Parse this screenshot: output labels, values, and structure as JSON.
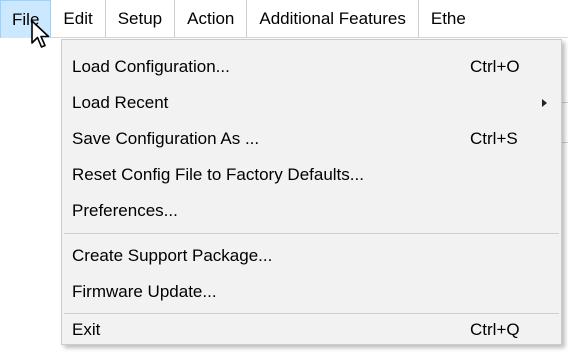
{
  "menubar": {
    "items": [
      {
        "label": "File",
        "active": true
      },
      {
        "label": "Edit"
      },
      {
        "label": "Setup"
      },
      {
        "label": "Action"
      },
      {
        "label": "Additional Features"
      },
      {
        "label": "Ethe"
      }
    ]
  },
  "file_menu": {
    "items": [
      {
        "label": "Load Configuration...",
        "shortcut": "Ctrl+O"
      },
      {
        "label": "Load Recent",
        "submenu": true
      },
      {
        "label": "Save Configuration As ...",
        "shortcut": "Ctrl+S"
      },
      {
        "label": "Reset Config File to Factory Defaults..."
      },
      {
        "label": "Preferences..."
      },
      {
        "label": "Create Support Package..."
      },
      {
        "label": "Firmware Update..."
      },
      {
        "label": "Exit",
        "shortcut": "Ctrl+Q"
      }
    ]
  },
  "colors": {
    "menubar_active_bg": "#cce8ff",
    "menubar_active_border": "#99d1ff",
    "dropdown_bg": "#f2f2f2"
  },
  "icons": {
    "cursor": "arrow-pointer-icon",
    "submenu": "chevron-right-icon"
  }
}
